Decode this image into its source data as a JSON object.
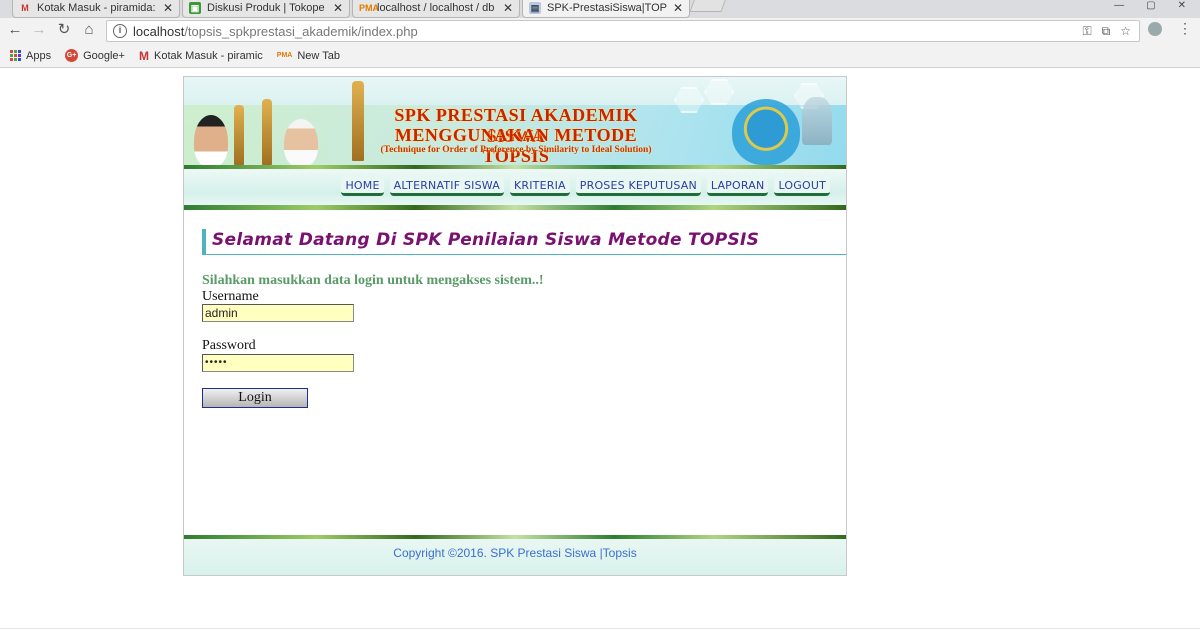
{
  "browser": {
    "tabs": [
      {
        "title": "Kotak Masuk - piramida:",
        "icon": "gmail-icon"
      },
      {
        "title": "Diskusi Produk | Tokope",
        "icon": "tokopedia-icon"
      },
      {
        "title": "localhost / localhost / db",
        "icon": "phpmyadmin-icon"
      },
      {
        "title": "SPK-PrestasiSiswa|TOPSIS",
        "icon": "page-icon"
      }
    ],
    "url_host": "localhost",
    "url_path": "/topsis_spkprestasi_akademik/index.php",
    "bookmarks": [
      {
        "label": "Apps",
        "icon": "apps-icon"
      },
      {
        "label": "Google+",
        "icon": "google-plus-icon"
      },
      {
        "label": "Kotak Masuk - piramic",
        "icon": "gmail-icon"
      },
      {
        "label": "New Tab",
        "icon": "phpmyadmin-icon"
      }
    ]
  },
  "header": {
    "title_line1": "SPK PRESTASI AKADEMIK SISWA",
    "title_line2": "MENGGUNAKAN METODE TOPSIS",
    "subtitle": "(Technique for Order of Preference by Similarity to Ideal Solution)"
  },
  "nav": {
    "items": [
      "HOME",
      "ALTERNATIF SISWA",
      "KRITERIA",
      "PROSES KEPUTUSAN",
      "LAPORAN",
      "LOGOUT"
    ]
  },
  "main": {
    "heading": "Selamat Datang Di SPK Penilaian Siswa Metode TOPSIS",
    "login_prompt": "Silahkan masukkan data login untuk mengakses sistem..!",
    "username_label": "Username",
    "username_value": "admin",
    "password_label": "Password",
    "password_value": "•••••",
    "login_button": "Login"
  },
  "footer": {
    "copyright": "Copyright ©2016. SPK Prestasi Siswa |Topsis"
  },
  "colors": {
    "title_red": "#cc2200",
    "nav_text": "#2a3ea0",
    "heading_purple": "#7a1070",
    "prompt_green": "#5a9a68",
    "footer_blue": "#3b6fd0",
    "input_bg": "#ffffc0"
  }
}
